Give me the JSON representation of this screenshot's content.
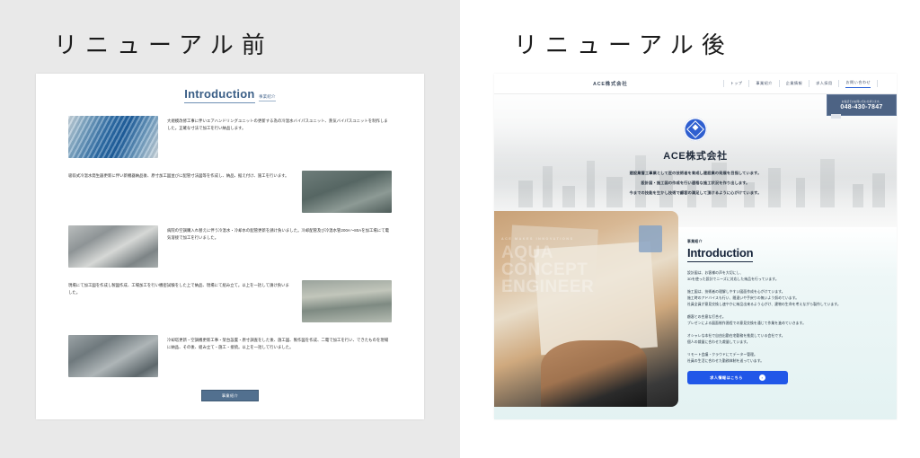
{
  "left": {
    "heading": "リニューアル前",
    "doc": {
      "title": "Introduction",
      "subtitle": "事業紹介",
      "blocks": [
        {
          "image": "piping-blue-unit-photo",
          "side": "left",
          "text": "大規模改修工事に伴いエアハンドリングユニットの更新する為の冷温水バイパスユニット、蒸気バイパスユニットを制作しました。正確な寸法で加工を行い納品します。"
        },
        {
          "image": "pipe-fitting-gray-photo",
          "side": "right",
          "text": "吸収式冷温水発生器更新に伴い新機器納品後、原寸加工図並びに配管寸法図等を作成し、納品、据え付け、施工を行います。"
        },
        {
          "image": "large-pipe-outdoor-photo",
          "side": "left",
          "text": "病院の空調購入れ替えに伴う冷温水・冷却水の配管更新を請け負いました。冷却配管及び冷温水管200A〜80Aを加工場にて電気溶接で加工を行いました。"
        },
        {
          "image": "workshop-fabrication-photo",
          "side": "right",
          "text": "現場にて加工図を作成し製図作成、工場加工を行い機密試験をした上で納品、現場にて組み立て。以上を一括して請け負いました。"
        },
        {
          "image": "rooftop-chiller-photo",
          "side": "left",
          "text": "冷却塔更新・空調機更新工事・架台設置・原寸調査をした後、施工図、製作図を作成、二電で加工を行い、できたものを現場に納品、その後、組み立て・施工・接続。以上を一括して行いました。"
        }
      ],
      "cta": "事業紹介"
    }
  },
  "right": {
    "heading": "リニューアル後",
    "site": {
      "brand": "ACE株式会社",
      "nav": [
        {
          "label": "トップ",
          "active": false
        },
        {
          "label": "事業紹介",
          "active": false
        },
        {
          "label": "企業情報",
          "active": false
        },
        {
          "label": "求人採用",
          "active": false
        },
        {
          "label": "お問い合わせ",
          "active": true
        }
      ],
      "phone": {
        "note": "お電話でのお問い合わせ承ります。",
        "number": "048-430-7847"
      },
      "hero": {
        "logo_icon": "ace-diamond-logo-icon",
        "title": "ACE株式会社",
        "lines": [
          "建設業管工事業として匠の技術者を育成し建設業の発展を目指しています。",
          "設計図・施工図の作成を行い適格な施工状況を作り出します。",
          "今までの技能を生かし技術で顧客の満足して頂けるように心がけています。"
        ]
      },
      "intro": {
        "photo_overlay_small": "ACE MAKES INNOVATIONS",
        "photo_overlay": [
          "AQUA",
          "CONCEPT",
          "ENGINEER"
        ],
        "kicker": "事業紹介",
        "title": "Introduction",
        "paragraphs": [
          "設計図は、お客様の声を大切にし、\n3Dを使った設計でニーズに対応した納品を行っています。",
          "施工図は、技術者の理解しやすい図面作成を心がけています。\n施工時のアドバイスも行い、間違いや手戻りの無いよう努めています。\n社員全員が意見交換し速やかに納品出来るよう心がけ、建物の生命を考えながら製作しています。",
          "顧客との合意な打合せ。\nプレゼンによる図面制作過程での意見交換を通じて作業を進めていきます。",
          "オシャレな本社で自由出勤在宅勤務を推奨している会社です。\n個人の裁量に合わせた裁量しています。",
          "リモート会議・クラウドにてデーター管理。\n社員の生活に合わせた勤務体制を送っています。"
        ],
        "button": {
          "label": "求人情報はこちら",
          "icon": "arrow-right-circle-icon"
        }
      }
    }
  },
  "colors": {
    "page_bg": "#ffffff",
    "left_bg": "#e9e9e9",
    "old_accent": "#52708f",
    "new_accent": "#2157e8",
    "phone_box": "#4d6384",
    "intro_bg": "#e3f2f2"
  }
}
